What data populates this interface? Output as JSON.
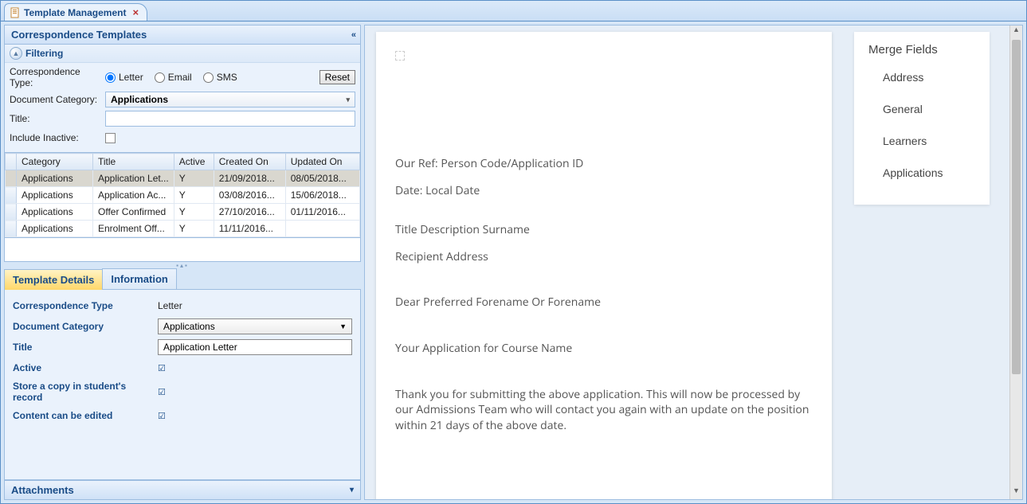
{
  "tab": {
    "title": "Template Management"
  },
  "panels": {
    "templates_header": "Correspondence Templates",
    "filtering_header": "Filtering",
    "attachments_header": "Attachments"
  },
  "filter": {
    "type_label": "Correspondence Type:",
    "letter": "Letter",
    "email": "Email",
    "sms": "SMS",
    "reset": "Reset",
    "doc_cat_label": "Document Category:",
    "doc_cat_value": "Applications",
    "title_label": "Title:",
    "title_value": "",
    "include_inactive_label": "Include Inactive:"
  },
  "grid": {
    "cols": [
      "Category",
      "Title",
      "Active",
      "Created On",
      "Updated On"
    ],
    "rows": [
      {
        "category": "Applications",
        "title": "Application Let...",
        "active": "Y",
        "created": "21/09/2018...",
        "updated": "08/05/2018..."
      },
      {
        "category": "Applications",
        "title": "Application Ac...",
        "active": "Y",
        "created": "03/08/2016...",
        "updated": "15/06/2018..."
      },
      {
        "category": "Applications",
        "title": "Offer Confirmed",
        "active": "Y",
        "created": "27/10/2016...",
        "updated": "01/11/2016..."
      },
      {
        "category": "Applications",
        "title": "Enrolment Off...",
        "active": "Y",
        "created": "11/11/2016...",
        "updated": ""
      }
    ]
  },
  "details_tabs": {
    "tab1": "Template Details",
    "tab2": "Information"
  },
  "details": {
    "corr_type_label": "Correspondence Type",
    "corr_type_value": "Letter",
    "doc_cat_label": "Document Category",
    "doc_cat_value": "Applications",
    "title_label": "Title",
    "title_value": "Application Letter",
    "active_label": "Active",
    "store_copy_label": "Store a copy in student's record",
    "editable_label": "Content can be edited"
  },
  "preview": {
    "our_ref": "Our Ref: Person Code/Application ID",
    "date": "Date: Local Date",
    "name_line": "Title Description Surname",
    "address": "Recipient Address",
    "dear": "Dear Preferred Forename Or Forename",
    "subject": "Your Application for  Course Name",
    "body": "Thank you for submitting the above application. This will now be processed by our Admissions Team who will contact you again with an update on the position within 21 days of the above date."
  },
  "merge": {
    "title": "Merge Fields",
    "items": [
      "Address",
      "General",
      "Learners",
      "Applications"
    ]
  }
}
